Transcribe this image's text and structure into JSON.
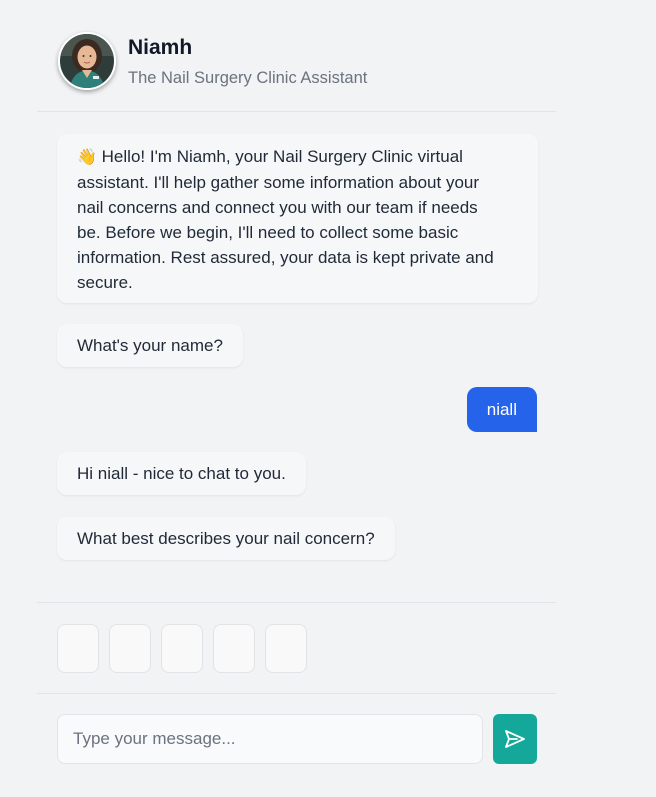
{
  "header": {
    "name": "Niamh",
    "subtitle": "The Nail Surgery Clinic Assistant"
  },
  "messages": {
    "intro_emoji": "👋",
    "intro_lines": [
      "Hello! I'm Niamh, your Nail Surgery Clinic virtual",
      "assistant. I'll help gather some information about your",
      "nail concerns and connect you with our team if needs",
      "be. Before we begin, I'll need to collect some basic",
      "information. Rest assured, your data is kept private and",
      "secure."
    ],
    "ask_name": "What's your name?",
    "user_reply": "niall",
    "greeting": "Hi niall - nice to chat to you.",
    "ask_concern": "What best describes your nail concern?"
  },
  "quick_replies": [
    "",
    "",
    "",
    "",
    ""
  ],
  "composer": {
    "placeholder": "Type your message...",
    "value": "",
    "send_icon": "send-icon"
  },
  "colors": {
    "user_bubble": "#2563eb",
    "send_button": "#14a89a",
    "background": "#f2f3f5"
  }
}
